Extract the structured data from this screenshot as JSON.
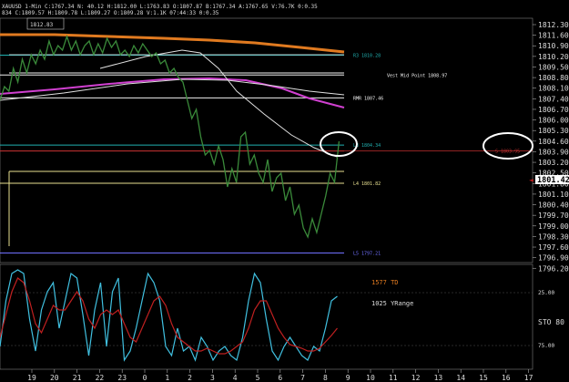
{
  "header": {
    "line1": "XAUUSD 1-Min  C:1767.34  N:  40.12  H:1812.00  L:1763.83  O:1807.87  B:1767.34  A:1767.65  V:76.7K  0:0.35",
    "line2": "834  C:1809.57  H:1809.78  L:1809.27  O:1809.28  V:1.1K  07:44:33  0:0.35",
    "top_box_label": "1812.83"
  },
  "price_axis": {
    "labels": [
      "1812.30",
      "1811.60",
      "1810.90",
      "1810.20",
      "1809.50",
      "1808.80",
      "1808.10",
      "1807.40",
      "1806.70",
      "1806.00",
      "1805.30",
      "1804.60",
      "1803.90",
      "1803.20",
      "1802.50",
      "1801.80",
      "1801.10",
      "1800.40",
      "1799.70",
      "1799.00",
      "1798.30",
      "1797.60",
      "1796.90",
      "1796.20"
    ],
    "current": "1801.42"
  },
  "levels": [
    {
      "label": "R3  1810.28",
      "price": 1810.28,
      "color": "#20b0b0"
    },
    {
      "label": "Vest Mid Point  1808.97",
      "price": 1808.97,
      "color": "#f0f0f0"
    },
    {
      "label": "RMR  1807.46",
      "price": 1807.46,
      "color": "#f0f0f0"
    },
    {
      "label": "L3  1804.34",
      "price": 1804.34,
      "color": "#20b0b0"
    },
    {
      "label": "S  1803.95",
      "price": 1803.95,
      "color": "#c03030"
    },
    {
      "label": "L4  1801.82",
      "price": 1801.82,
      "color": "#e8e090"
    },
    {
      "label": "L5  1797.21",
      "price": 1797.21,
      "color": "#7070ff"
    }
  ],
  "indicator": {
    "label_td": "1577 TD",
    "label_yr": "1025 YRange",
    "right_top": "25.00",
    "right_bottom": "75.00",
    "name": "STO  80"
  },
  "time_axis": {
    "labels": [
      "19",
      "20",
      "21",
      "22",
      "23",
      "0",
      "1",
      "2",
      "3",
      "4",
      "5",
      "6",
      "7",
      "8",
      "9",
      "10",
      "11",
      "12",
      "13",
      "14",
      "15",
      "16",
      "17"
    ]
  },
  "colors": {
    "background": "#000000",
    "price": "#3a8a3a",
    "orange_ma": "#e07a20",
    "magenta_ma": "#d040d0",
    "stoch_fast": "#40c0e0",
    "stoch_slow": "#c02020",
    "axis_text": "#dddddd"
  }
}
